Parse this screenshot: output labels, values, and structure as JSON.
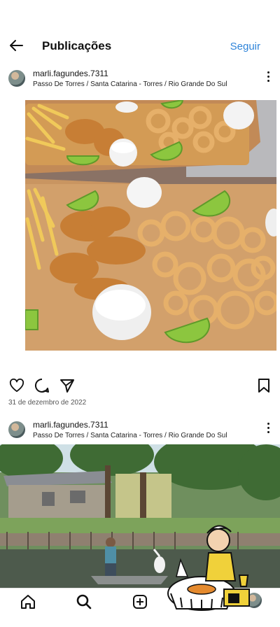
{
  "header": {
    "title": "Publicações",
    "follow_label": "Seguir"
  },
  "posts": [
    {
      "username": "marli.fagundes.7311",
      "location": "Passo De Torres / Santa Catarina - Torres / Rio Grande Do Sul",
      "date": "31 de dezembro de 2022"
    },
    {
      "username": "marli.fagundes.7311",
      "location": "Passo De Torres / Santa Catarina - Torres / Rio Grande Do Sul"
    }
  ],
  "icons": {
    "back": "arrow-left-icon",
    "like": "heart-icon",
    "comment": "comment-icon",
    "share": "send-icon",
    "save": "bookmark-icon",
    "home": "home-icon",
    "search": "search-icon",
    "create": "add-post-icon"
  },
  "colors": {
    "accent": "#2f84d9"
  }
}
